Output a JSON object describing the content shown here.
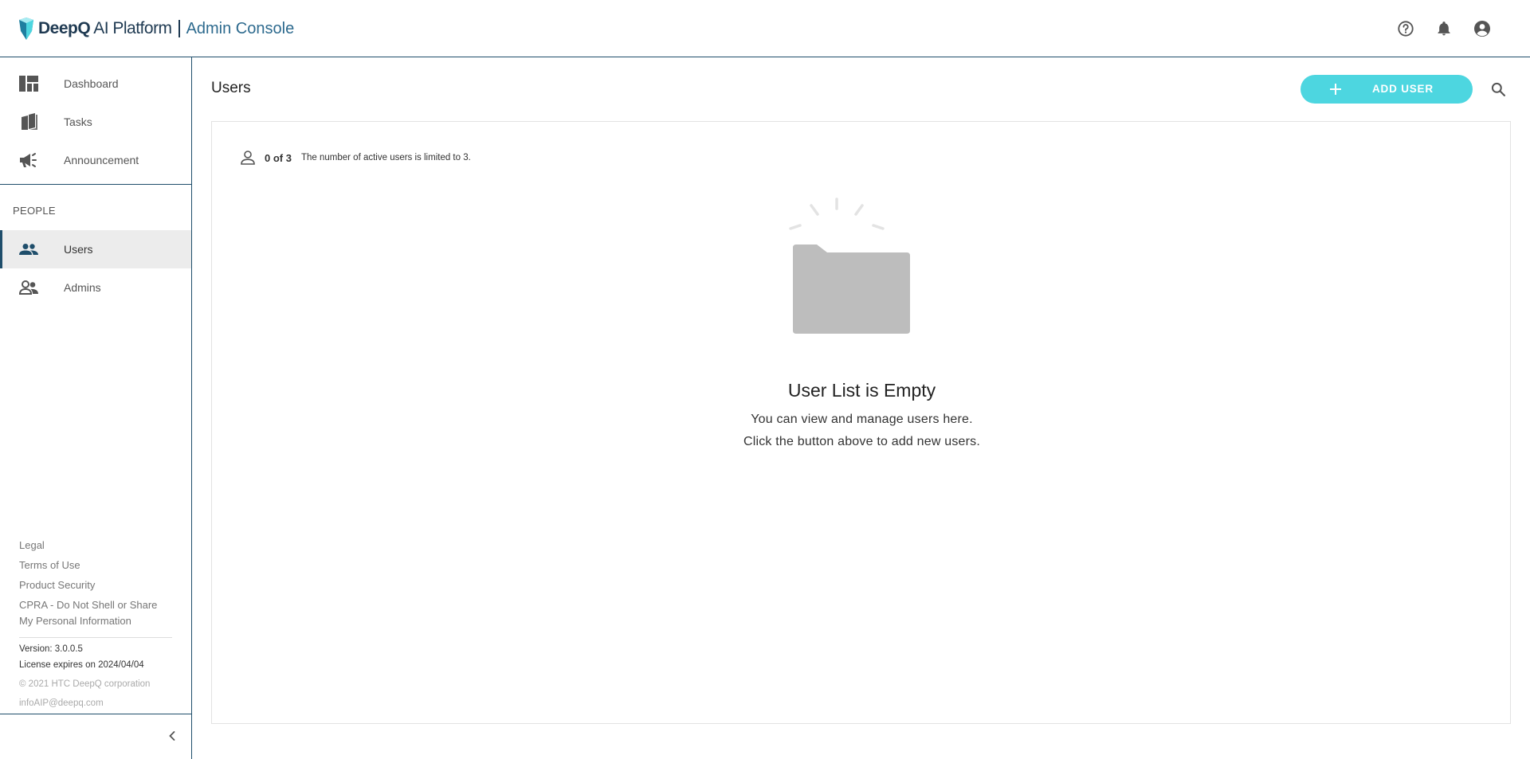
{
  "header": {
    "brand_name": "DeepQ",
    "brand_product": "AI Platform",
    "console_label": "Admin Console",
    "icons": [
      "help-icon",
      "notification-bell-icon",
      "account-circle-icon"
    ]
  },
  "sidebar": {
    "nav_items": [
      {
        "label": "Dashboard",
        "icon": "dashboard-icon"
      },
      {
        "label": "Tasks",
        "icon": "tasks-icon"
      },
      {
        "label": "Announcement",
        "icon": "megaphone-icon"
      }
    ],
    "people_section_title": "PEOPLE",
    "people_items": [
      {
        "label": "Users",
        "icon": "people-icon",
        "active": true
      },
      {
        "label": "Admins",
        "icon": "admin-people-icon",
        "active": false
      }
    ],
    "footer_links": [
      "Legal",
      "Terms of Use",
      "Product Security",
      "CPRA - Do Not Shell or Share",
      "My Personal Information"
    ],
    "version": "Version: 3.0.0.5",
    "license": "License expires on 2024/04/04",
    "copyright": "© 2021 HTC DeepQ corporation",
    "email": "infoAIP@deepq.com"
  },
  "main": {
    "title": "Users",
    "add_button_label": "ADD USER",
    "user_count": "0 of 3",
    "user_limit_note": "The number of active users is limited to 3.",
    "empty_title": "User List is Empty",
    "empty_line1": "You can view and manage users here.",
    "empty_line2": "Click the button above to add new users."
  },
  "colors": {
    "accent": "#4dd6e0",
    "brand_dark": "#1f3a52",
    "border": "#1f4e6b",
    "active_bg": "#ececec",
    "illustration_gray": "#bdbdbd"
  }
}
